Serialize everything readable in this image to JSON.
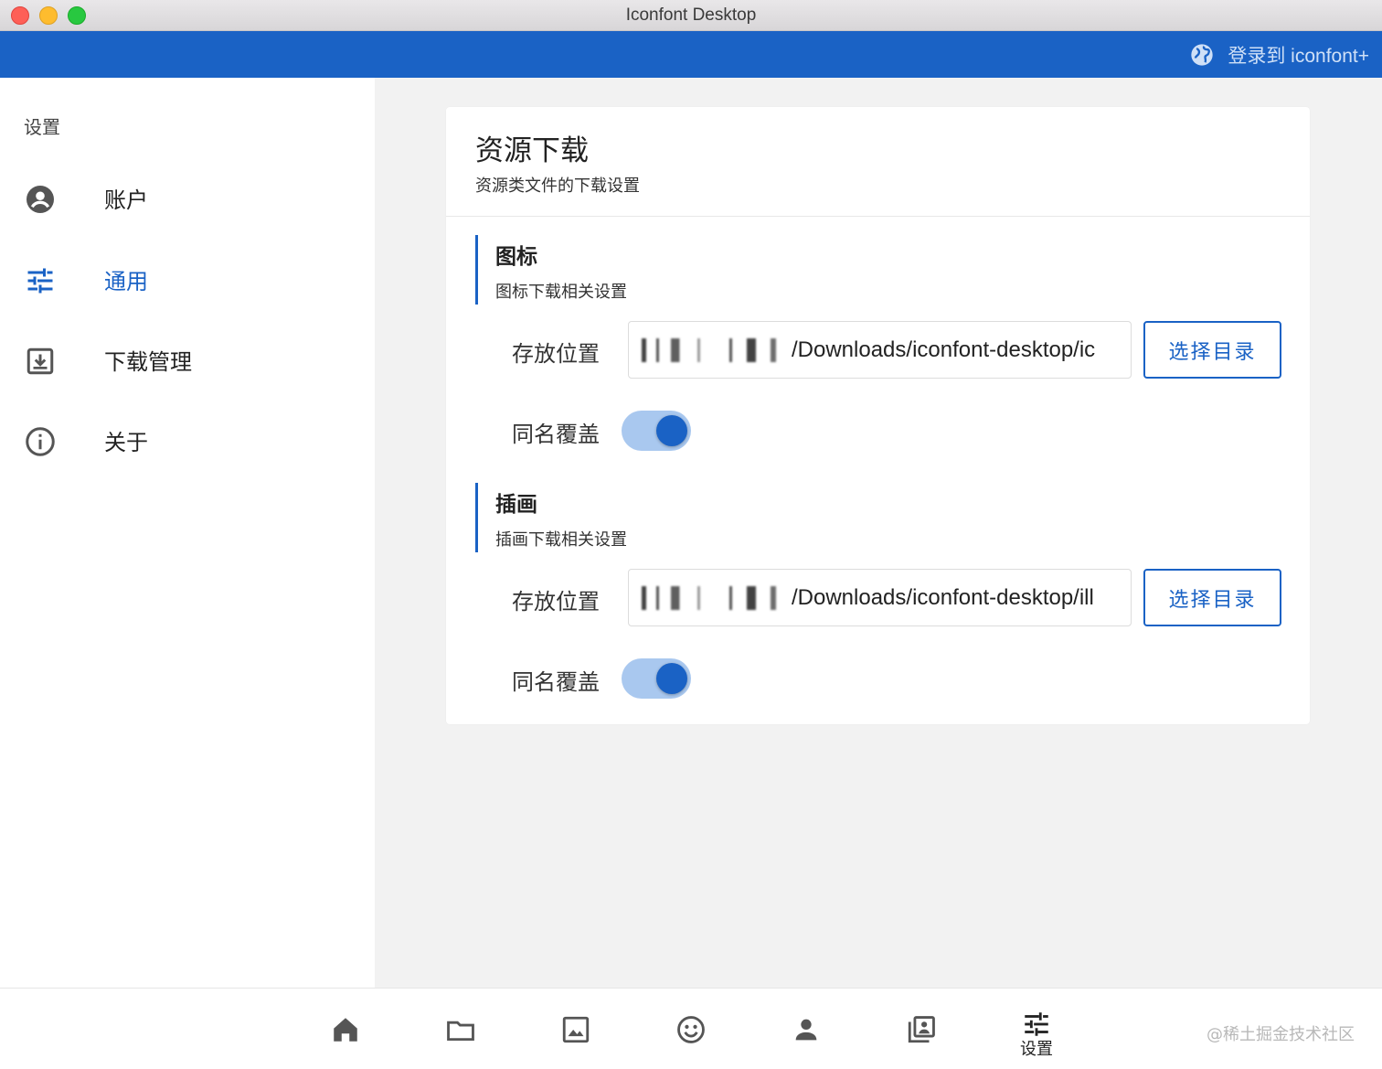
{
  "window": {
    "title": "Iconfont Desktop"
  },
  "appbar": {
    "login_label": "登录到 iconfont+",
    "login_icon": "globe-icon"
  },
  "sidebar": {
    "title": "设置",
    "items": [
      {
        "label": "账户",
        "icon": "account-circle-icon",
        "active": false
      },
      {
        "label": "通用",
        "icon": "tune-sliders-icon",
        "active": true
      },
      {
        "label": "下载管理",
        "icon": "download-box-icon",
        "active": false
      },
      {
        "label": "关于",
        "icon": "info-circle-icon",
        "active": false
      }
    ]
  },
  "main": {
    "title": "资源下载",
    "subtitle": "资源类文件的下载设置",
    "sections": [
      {
        "title": "图标",
        "subtitle": "图标下载相关设置",
        "path_label": "存放位置",
        "path_value": "/Downloads/iconfont-desktop/ic",
        "pick_label": "选择目录",
        "overwrite_label": "同名覆盖",
        "overwrite_on": true
      },
      {
        "title": "插画",
        "subtitle": "插画下载相关设置",
        "path_label": "存放位置",
        "path_value": "/Downloads/iconfont-desktop/ill",
        "pick_label": "选择目录",
        "overwrite_label": "同名覆盖",
        "overwrite_on": true
      }
    ]
  },
  "bottom_tabs": [
    {
      "icon": "home-icon",
      "label": ""
    },
    {
      "icon": "folder-icon",
      "label": ""
    },
    {
      "icon": "image-icon",
      "label": ""
    },
    {
      "icon": "smiley-icon",
      "label": ""
    },
    {
      "icon": "person-icon",
      "label": ""
    },
    {
      "icon": "photo-library-icon",
      "label": ""
    },
    {
      "icon": "tune-sliders-icon",
      "label": "设置",
      "active": true
    }
  ],
  "watermark": "@稀土掘金技术社区",
  "colors": {
    "accent": "#1a62c5",
    "toggle_track": "#a9c8ef",
    "background": "#f2f2f2"
  }
}
